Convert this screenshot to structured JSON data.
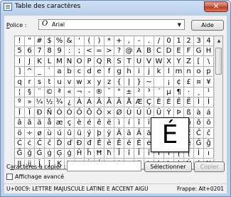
{
  "window": {
    "title": "Table des caractères",
    "close_glyph": "✕"
  },
  "police": {
    "label_prefix": "",
    "label_underlined": "P",
    "label_rest": "olice :",
    "font_icon_glyph": "O",
    "font_name": "Arial",
    "dropdown_glyph": "▼"
  },
  "buttons": {
    "aide": "Aide",
    "select": "Sélectionner",
    "copier": "Copier"
  },
  "grid_rows": [
    [
      "!",
      "\"",
      "#",
      "$",
      "%",
      "&",
      "'",
      "(",
      ")",
      "*",
      "+",
      ",",
      "-",
      ".",
      "/",
      "0",
      "1",
      "2",
      "3",
      "4"
    ],
    [
      "5",
      "6",
      "7",
      "8",
      "9",
      ":",
      ";",
      "<",
      "=",
      ">",
      "?",
      "@",
      "A",
      "B",
      "C",
      "D",
      "E",
      "F",
      "G",
      "H"
    ],
    [
      "I",
      "J",
      "K",
      "L",
      "M",
      "N",
      "O",
      "P",
      "Q",
      "R",
      "S",
      "T",
      "U",
      "V",
      "W",
      "X",
      "Y",
      "Z",
      "[",
      "\\"
    ],
    [
      "]",
      "^",
      "_",
      "`",
      "a",
      "b",
      "c",
      "d",
      "e",
      "f",
      "g",
      "h",
      "i",
      "j",
      "k",
      "l",
      "m",
      "n",
      "o",
      "p"
    ],
    [
      "q",
      "r",
      "s",
      "t",
      "u",
      "v",
      "w",
      "x",
      "y",
      "z",
      "{",
      "|",
      "}",
      "~",
      " ",
      "¡",
      "¢",
      "£",
      "¤",
      "¥"
    ],
    [
      "¦",
      "§",
      "¨",
      "©",
      "ª",
      "«",
      "¬",
      "-",
      "®",
      "¯",
      "°",
      "±",
      "²",
      "³",
      "´",
      "µ",
      "¶",
      "·",
      "¸",
      "¹"
    ],
    [
      "º",
      "»",
      "¼",
      "½",
      "¾",
      "¿",
      "À",
      "Á",
      "Â",
      "Ã",
      "Ä",
      "Å",
      "Æ",
      "Ç",
      "È",
      "É",
      "Ê",
      "Ë",
      "Ì",
      "Í"
    ],
    [
      "Î",
      "Ï",
      "Ð",
      "Ñ",
      "Ò",
      "Ó",
      "Ô",
      "Õ",
      "Ö",
      "×",
      "Ø",
      "Ù",
      "Ú",
      "Û",
      "Ü",
      "Ý",
      "Þ",
      "ß",
      "à",
      "á"
    ],
    [
      "â",
      "ã",
      "ä",
      "å",
      "æ",
      "ç",
      "è",
      "é",
      "ê",
      "ë",
      "ì",
      "í",
      "î",
      "ï",
      "ð",
      "ñ",
      "ò",
      "ó",
      "ô",
      "õ"
    ],
    [
      "ö",
      "÷",
      "ø",
      "ù",
      "ú",
      "û",
      "ü",
      "ý",
      "þ",
      "ÿ",
      "Ā",
      "ā",
      "Ă",
      "ă",
      "Ą",
      "ą",
      "Ć",
      "ć",
      "Ĉ",
      "ĉ"
    ],
    [
      "Ċ",
      "ċ",
      "Č",
      "č",
      "Ď",
      "ď",
      "Đ",
      "đ",
      "Ē",
      "ē",
      "Ĕ",
      "ĕ",
      "Ė",
      "ė",
      "Ę",
      "ę",
      "Ě",
      "ě",
      "Ĝ",
      "ĝ"
    ],
    [
      "Ğ",
      "ğ",
      "Ġ",
      "ġ",
      "Ģ",
      "ģ",
      "Ĥ",
      "ĥ",
      "Ħ",
      "ħ",
      "Ĩ",
      "ĩ",
      "Ī",
      "ī",
      "Ĭ",
      "ĭ",
      "Į",
      "į",
      "İ",
      "ı"
    ],
    [
      "Ĳ",
      "ĳ",
      "Ĵ",
      "ĵ",
      "Ķ",
      "ķ",
      "ĸ",
      "Ĺ",
      "ĺ",
      "Ļ",
      "ļ",
      "Ľ",
      "ľ",
      "Ŀ",
      "ŀ",
      "Ł",
      "ł",
      "Ń",
      "ń",
      "Ņ"
    ]
  ],
  "zoom_char": "É",
  "copy": {
    "label_prefix": "C",
    "label_underlined": "a",
    "label_rest": "ractères à copier :",
    "value": ""
  },
  "advanced": {
    "label": "Affichage avancé",
    "checked": false
  },
  "scrollbar": {
    "up_glyph": "▲",
    "down_glyph": "▼"
  },
  "status": {
    "left": "U+00C9: LETTRE MAJUSCULE LATINE E ACCENT AIGU",
    "right": "Frappe: Alt+0201"
  }
}
